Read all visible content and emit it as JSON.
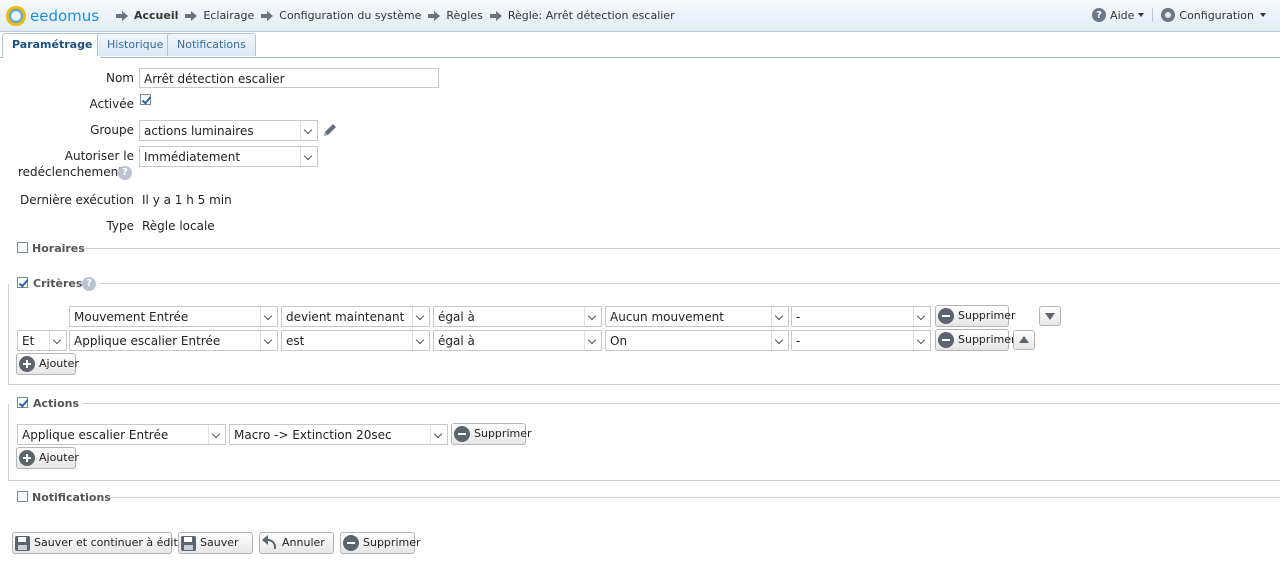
{
  "app": {
    "logo_text": "eedomus"
  },
  "breadcrumb": [
    "Accueil",
    "Eclairage",
    "Configuration du système",
    "Règles",
    "Règle: Arrêt détection escalier"
  ],
  "topright": {
    "help_label": "Aide",
    "config_label": "Configuration"
  },
  "tabs": [
    "Paramétrage",
    "Historique",
    "Notifications"
  ],
  "form": {
    "nom_label": "Nom",
    "nom_value": "Arrêt détection escalier",
    "activee_label": "Activée",
    "activee_checked": true,
    "groupe_label": "Groupe",
    "groupe_value": "actions luminaires",
    "autoriser_label_1": "Autoriser le",
    "autoriser_label_2": "redéclenchement",
    "autoriser_value": "Immédiatement",
    "derniere_label": "Dernière exécution",
    "derniere_value": "Il y a 1 h 5 min",
    "type_label": "Type",
    "type_value": "Règle locale"
  },
  "sections": {
    "horaires": "Horaires",
    "criteres": "Critères",
    "actions": "Actions",
    "notifications": "Notifications"
  },
  "criteria": [
    {
      "conj": "",
      "device": "Mouvement Entrée",
      "op": "devient maintenant",
      "cmp": "égal à",
      "value": "Aucun mouvement",
      "extra": "-",
      "delete": "Supprimer"
    },
    {
      "conj": "Et",
      "device": "Applique escalier Entrée",
      "op": "est",
      "cmp": "égal à",
      "value": "On",
      "extra": "-",
      "delete": "Supprimer"
    }
  ],
  "add_label": "Ajouter",
  "actions_list": [
    {
      "device": "Applique escalier Entrée",
      "action": "Macro -> Extinction 20sec",
      "delete": "Supprimer"
    }
  ],
  "footer": {
    "save_continue": "Sauver et continuer à éditer",
    "save": "Sauver",
    "cancel": "Annuler",
    "delete": "Supprimer"
  }
}
